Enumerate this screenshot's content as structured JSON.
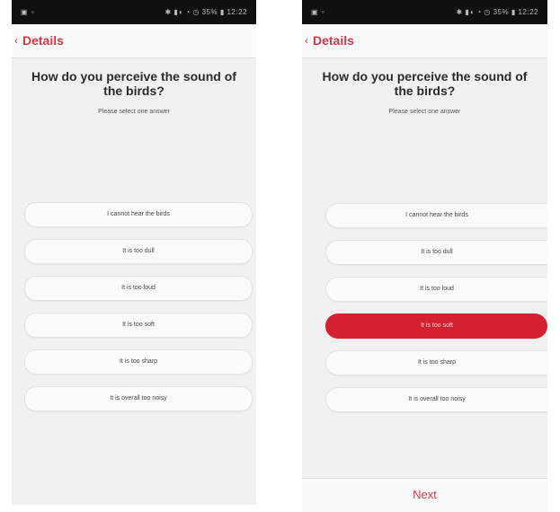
{
  "status_bar": {
    "left_icons": "▣ ▫",
    "right_icons": "✱ ▮◖ ◔ ◷ 35% ▮ 12:22"
  },
  "nav": {
    "back_icon": "chevron-left",
    "title": "Details"
  },
  "question": {
    "text": "How do you perceive the sound of the birds?",
    "instruction": "Please select one answer"
  },
  "options": [
    {
      "label": "I cannot hear the birds"
    },
    {
      "label": "It is too dull"
    },
    {
      "label": "It is too loud"
    },
    {
      "label": "It is too soft"
    },
    {
      "label": "It is too sharp"
    },
    {
      "label": "It is overall too noisy"
    }
  ],
  "selected_option_right": "It is too soft",
  "next_button": {
    "label": "Next"
  },
  "colors": {
    "accent": "#d3212f",
    "nav_text": "#d8374a",
    "screen_bg": "#f1f1f1"
  }
}
